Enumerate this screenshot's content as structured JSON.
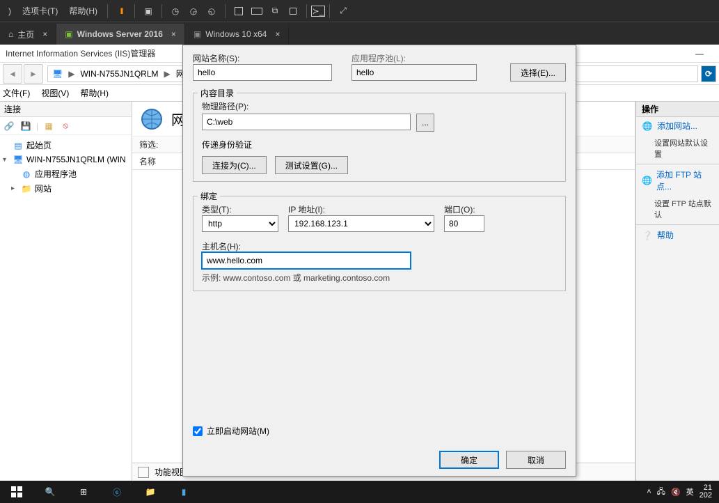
{
  "vm_toolbar": {
    "menu_tabs": "选项卡(T)",
    "menu_help": "帮助(H)"
  },
  "vm_tabs": {
    "home": "主页",
    "ws2016": "Windows Server 2016",
    "win10": "Windows 10 x64"
  },
  "iis": {
    "title": "Internet Information Services (IIS)管理器",
    "breadcrumb": {
      "node1": "WIN-N755JN1QRLM",
      "node2": "网"
    },
    "menu": {
      "file": "文件(F)",
      "view": "视图(V)",
      "help": "帮助(H)"
    },
    "left": {
      "header": "连接",
      "start": "起始页",
      "server": "WIN-N755JN1QRLM (WIN",
      "apppool": "应用程序池",
      "sites": "网站"
    },
    "center": {
      "title": "网",
      "filter_label": "筛选:",
      "name_col": "名称",
      "bottom_tab": "功能视图"
    },
    "actions": {
      "header": "操作",
      "add_site": "添加网站...",
      "set_defaults": "设置网站默认设置",
      "add_ftp": "添加 FTP 站点...",
      "set_ftp_defaults": "设置 FTP 站点默认",
      "help": "帮助"
    }
  },
  "dialog": {
    "site_name_label": "网站名称(S):",
    "site_name_value": "hello",
    "app_pool_label": "应用程序池(L):",
    "app_pool_value": "hello",
    "select_btn": "选择(E)...",
    "content_section": "内容目录",
    "phys_path_label": "物理路径(P):",
    "phys_path_value": "C:\\web",
    "browse_btn": "...",
    "auth_label": "传递身份验证",
    "connect_as_btn": "连接为(C)...",
    "test_btn": "测试设置(G)...",
    "binding_section": "绑定",
    "type_label": "类型(T):",
    "type_value": "http",
    "ip_label": "IP 地址(I):",
    "ip_value": "192.168.123.1",
    "port_label": "端口(O):",
    "port_value": "80",
    "hostname_label": "主机名(H):",
    "hostname_value": "www.hello.com",
    "example_hint": "示例: www.contoso.com 或 marketing.contoso.com",
    "start_now_label": "立即启动网站(M)",
    "ok_btn": "确定",
    "cancel_btn": "取消"
  },
  "taskbar": {
    "ime": "英",
    "time_top": "21",
    "time_bottom": "202"
  }
}
